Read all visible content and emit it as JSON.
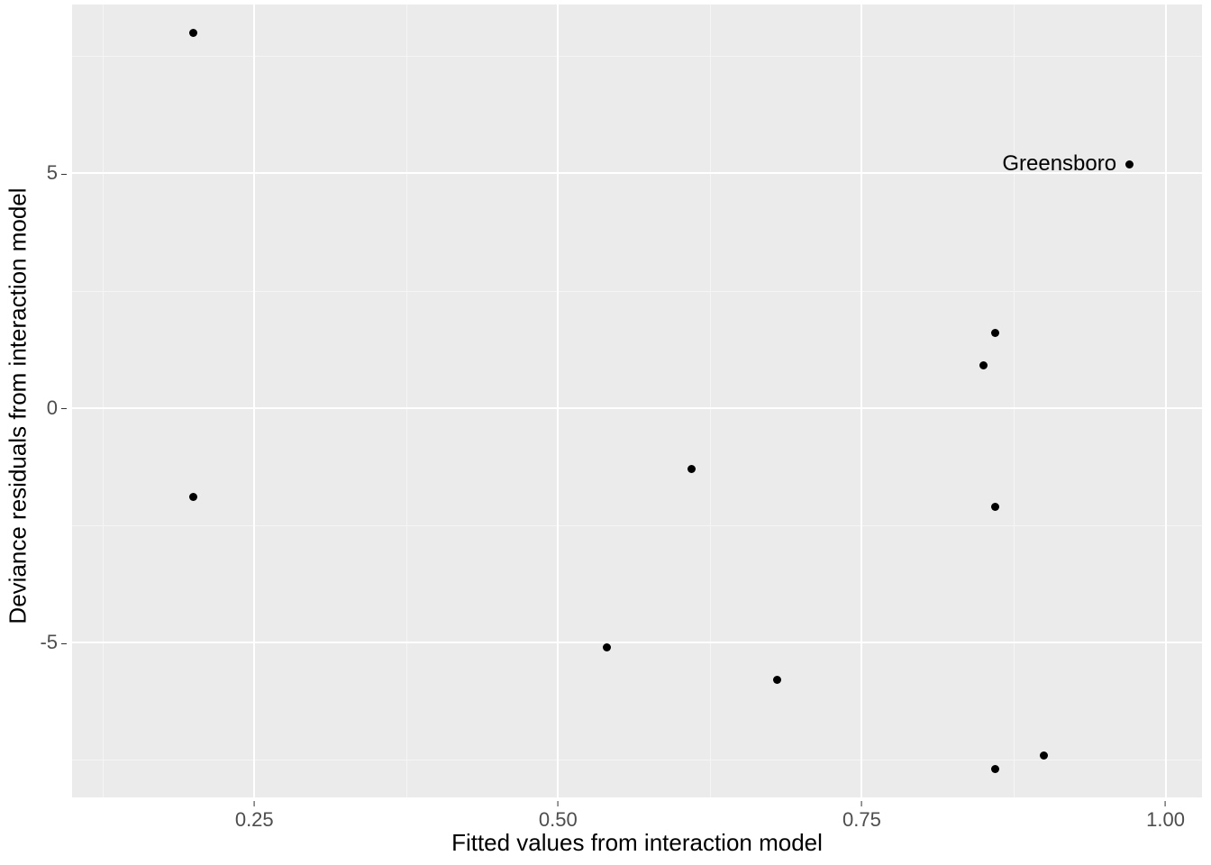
{
  "chart_data": {
    "type": "scatter",
    "xlabel": "Fitted values from interaction model",
    "ylabel": "Deviance residuals from interaction model",
    "xlim": [
      0.1,
      1.03
    ],
    "ylim": [
      -8.3,
      8.6
    ],
    "x_ticks": [
      0.25,
      0.5,
      0.75,
      1.0
    ],
    "y_ticks": [
      -5,
      0,
      5
    ],
    "x_minor": [
      0.125,
      0.375,
      0.625,
      0.875
    ],
    "y_minor": [
      -7.5,
      -2.5,
      2.5,
      7.5
    ],
    "points": [
      {
        "x": 0.2,
        "y": 8.0,
        "label": ""
      },
      {
        "x": 0.2,
        "y": -1.9,
        "label": ""
      },
      {
        "x": 0.54,
        "y": -5.1,
        "label": ""
      },
      {
        "x": 0.61,
        "y": -1.3,
        "label": ""
      },
      {
        "x": 0.68,
        "y": -5.8,
        "label": ""
      },
      {
        "x": 0.85,
        "y": 0.9,
        "label": ""
      },
      {
        "x": 0.86,
        "y": 1.6,
        "label": ""
      },
      {
        "x": 0.86,
        "y": -2.1,
        "label": ""
      },
      {
        "x": 0.86,
        "y": -7.7,
        "label": ""
      },
      {
        "x": 0.9,
        "y": -7.4,
        "label": ""
      },
      {
        "x": 0.97,
        "y": 5.2,
        "label": "Greensboro"
      }
    ]
  }
}
